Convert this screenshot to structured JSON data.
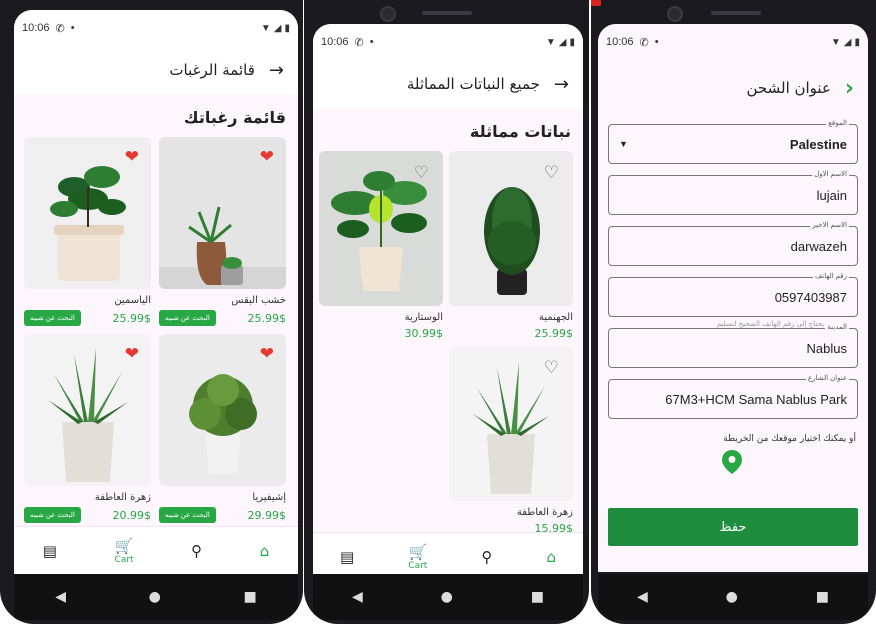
{
  "status": {
    "time": "10:06",
    "wifi_icon": "wifi-icon",
    "signal_icon": "signal-icon",
    "battery_icon": "battery-icon"
  },
  "wishlist": {
    "appbar_title": "قائمة الرغبات",
    "section_title": "قائمة رغباتك",
    "similar_label": "البحث عن شبيه",
    "items": [
      {
        "name": "الياسمين",
        "price": "25.99$"
      },
      {
        "name": "خشب البقس",
        "price": "25.99$"
      },
      {
        "name": "زهرة العاطفة",
        "price": "20.99$"
      },
      {
        "name": "إشيفيريا",
        "price": "29.99$"
      }
    ],
    "nav": {
      "cart": "Cart"
    }
  },
  "similar": {
    "appbar_title": "جميع النباتات المماثلة",
    "section_title": "نباتات مماثلة",
    "items": [
      {
        "name": "الوستارية",
        "price": "30.99$"
      },
      {
        "name": "الجهنمية",
        "price": "25.99$"
      },
      {
        "name": "زهرة العاطفة",
        "price": "15.99$"
      }
    ],
    "nav": {
      "cart": "Cart"
    }
  },
  "shipping": {
    "appbar_title": "عنوان الشحن",
    "fields": {
      "location": {
        "label": "الموقع",
        "value": "Palestine"
      },
      "first_name": {
        "label": "الاسم الاول",
        "value": "lujain"
      },
      "last_name": {
        "label": "الاسم الاخير",
        "value": "darwazeh"
      },
      "phone": {
        "label": "رقم الهاتف",
        "value": "0597403987",
        "hint": "يحتاج إلى رقم الهاتف الصحيح لتسليم"
      },
      "city": {
        "label": "المدينة",
        "value": "Nablus"
      },
      "street": {
        "label": "عنوان الشارع",
        "value": "67M3+HCM Sama Nablus Park"
      }
    },
    "map_hint": "أو يمكنك اختيار موقعك من الخريطة",
    "save_label": "حفظ"
  },
  "colors": {
    "accent": "#28a745",
    "heart": "#e53935",
    "screen_bg": "#fdf6fd"
  }
}
